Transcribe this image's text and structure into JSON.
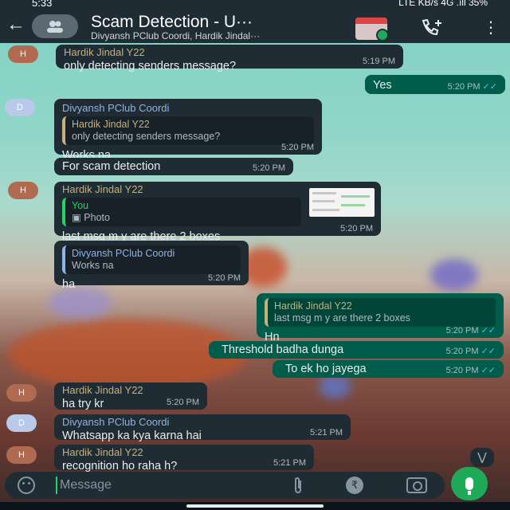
{
  "status_bar": {
    "time": "5:33",
    "right_info": "LTE KB/s 4G .ıll 35%"
  },
  "header": {
    "title": "Scam Detection - U···",
    "subtitle": "Divyansh PClub Coordi, Hardik Jindal···",
    "icons": [
      "back-arrow-icon",
      "group-avatar-icon",
      "calendar-icon",
      "add-call-icon",
      "more-vert-icon"
    ]
  },
  "messages": [
    {
      "type": "in",
      "avatar": "H",
      "sender": "Hardik Jindal Y22",
      "text": "only detecting senders message?",
      "time": "5:19 PM"
    },
    {
      "type": "out",
      "text": "Yes",
      "time": "5:20 PM"
    },
    {
      "type": "in",
      "avatar": "D",
      "sender": "Divyansh PClub Coordi",
      "quote_name": "Hardik Jindal Y22",
      "quote_text": "only detecting senders message?",
      "text": "Works na",
      "time": "5:20 PM"
    },
    {
      "type": "in",
      "text": "For scam detection",
      "time": "5:20 PM"
    },
    {
      "type": "in",
      "avatar": "H",
      "sender": "Hardik Jindal Y22",
      "quote_name": "You",
      "quote_text": "Photo",
      "text": "last msg m y are there 2 boxes",
      "time": "5:20 PM"
    },
    {
      "type": "in",
      "quote_name": "Divyansh PClub Coordi",
      "quote_text": "Works na",
      "text": "ha",
      "time": "5:20 PM"
    },
    {
      "type": "out",
      "quote_name": "Hardik Jindal Y22",
      "quote_text": "last msg m y are there 2 boxes",
      "text": "Hn",
      "time": "5:20 PM"
    },
    {
      "type": "out",
      "text": "Threshold badha dunga",
      "time": "5:20 PM"
    },
    {
      "type": "out",
      "text": "To ek ho jayega",
      "time": "5:20 PM"
    },
    {
      "type": "in",
      "avatar": "H",
      "sender": "Hardik Jindal Y22",
      "text": "ha try kr",
      "time": "5:20 PM"
    },
    {
      "type": "in",
      "avatar": "D",
      "sender": "Divyansh PClub Coordi",
      "text": "Whatsapp ka kya karna hai",
      "time": "5:21 PM"
    },
    {
      "type": "in",
      "avatar": "H",
      "sender": "Hardik Jindal Y22",
      "text": "recognition ho raha h?",
      "time": "5:21 PM"
    }
  ],
  "composer": {
    "placeholder": "Message",
    "icons": [
      "emoji-icon",
      "attach-icon",
      "rupee-icon",
      "camera-icon",
      "mic-icon"
    ]
  },
  "colors": {
    "header": "#1f2c34",
    "bubble_in": "#1f2c34",
    "bubble_out": "#005c4b",
    "accent_green": "#1faa59",
    "read_ticks": "#53bdeb"
  }
}
